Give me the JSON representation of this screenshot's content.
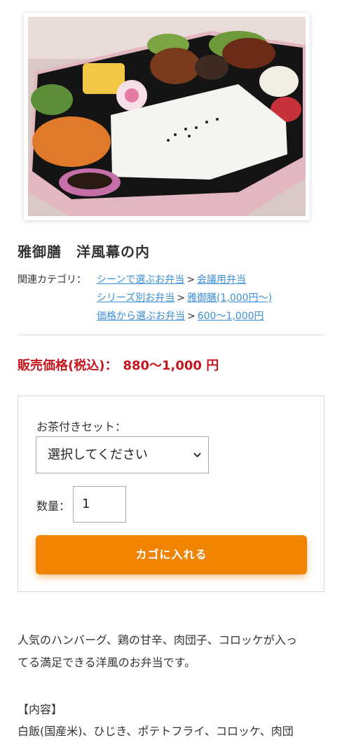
{
  "product": {
    "image_alt": "雅御膳 洋風幕の内 bento photo",
    "title": "雅御膳　洋風幕の内"
  },
  "categories": {
    "label": "関連カテゴリ：",
    "rows": [
      {
        "parent": "シーンで選ぶお弁当",
        "sep": ">",
        "child": "会議用弁当"
      },
      {
        "parent": "シリーズ別お弁当",
        "sep": ">",
        "child": "雅御膳(1,000円～)"
      },
      {
        "parent": "価格から選ぶお弁当",
        "sep": ">",
        "child": "600～1,000円"
      }
    ]
  },
  "price": {
    "label": "販売価格(税込)：",
    "value": "880～1,000 円",
    "color": "#c4161c"
  },
  "cart": {
    "set_label": "お茶付きセット：",
    "select_value": "選択してください",
    "qty_label": "数量：",
    "qty_value": "1",
    "button_label": "カゴに入れる",
    "button_color": "#f08300"
  },
  "description": {
    "line1": "人気のハンバーグ、鶏の甘辛、肉団子、コロッケが入っ",
    "line2": "てる満足できる洋風のお弁当です。",
    "contents_heading": "【内容】",
    "contents_text": "白飯(国産米)、ひじき、ポテトフライ、コロッケ、肉団"
  }
}
